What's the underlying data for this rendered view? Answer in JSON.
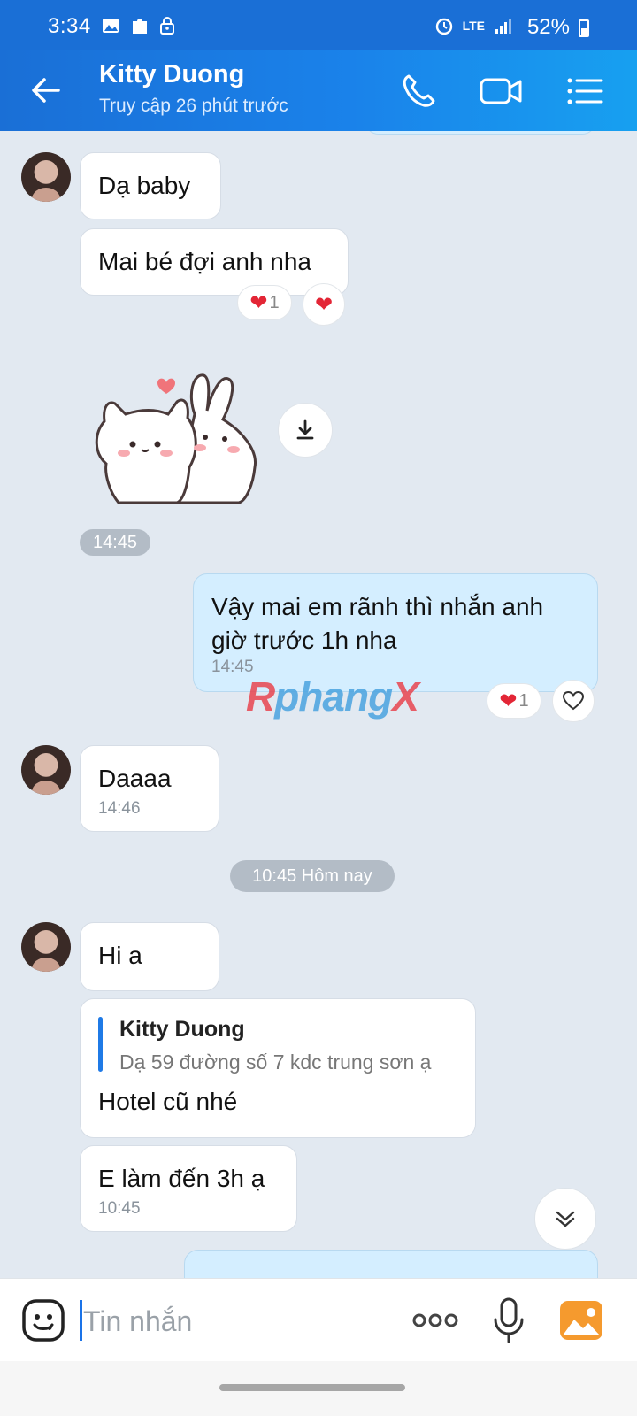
{
  "status": {
    "time": "3:34",
    "battery": "52%",
    "network": "LTE"
  },
  "header": {
    "name": "Kitty Duong",
    "subtitle": "Truy cập 26 phút trước"
  },
  "messages": {
    "m1": "Dạ baby",
    "m2": "Mai bé đợi anh nha",
    "m2_react_count": "1",
    "sticker_time": "14:45",
    "m3": "Vậy mai em rãnh thì nhắn anh giờ trước 1h nha",
    "m3_time": "14:45",
    "m3_react_count": "1",
    "m4": "Daaaa",
    "m4_time": "14:46",
    "divider": "10:45 Hôm nay",
    "m5": "Hi a",
    "quote_author": "Kitty Duong",
    "quote_text": "Dạ 59 đường số 7 kdc trung sơn ạ",
    "m6": "Hotel cũ nhé",
    "m7": "E làm đến 3h ạ",
    "m7_time": "10:45"
  },
  "watermark": {
    "part1": "R",
    "part2": "phang",
    "part3": "X"
  },
  "input": {
    "placeholder": "Tin nhắn"
  },
  "colors": {
    "header": "#1a82ea",
    "my_bubble": "#d4eeff",
    "background": "#e2e9f1"
  }
}
